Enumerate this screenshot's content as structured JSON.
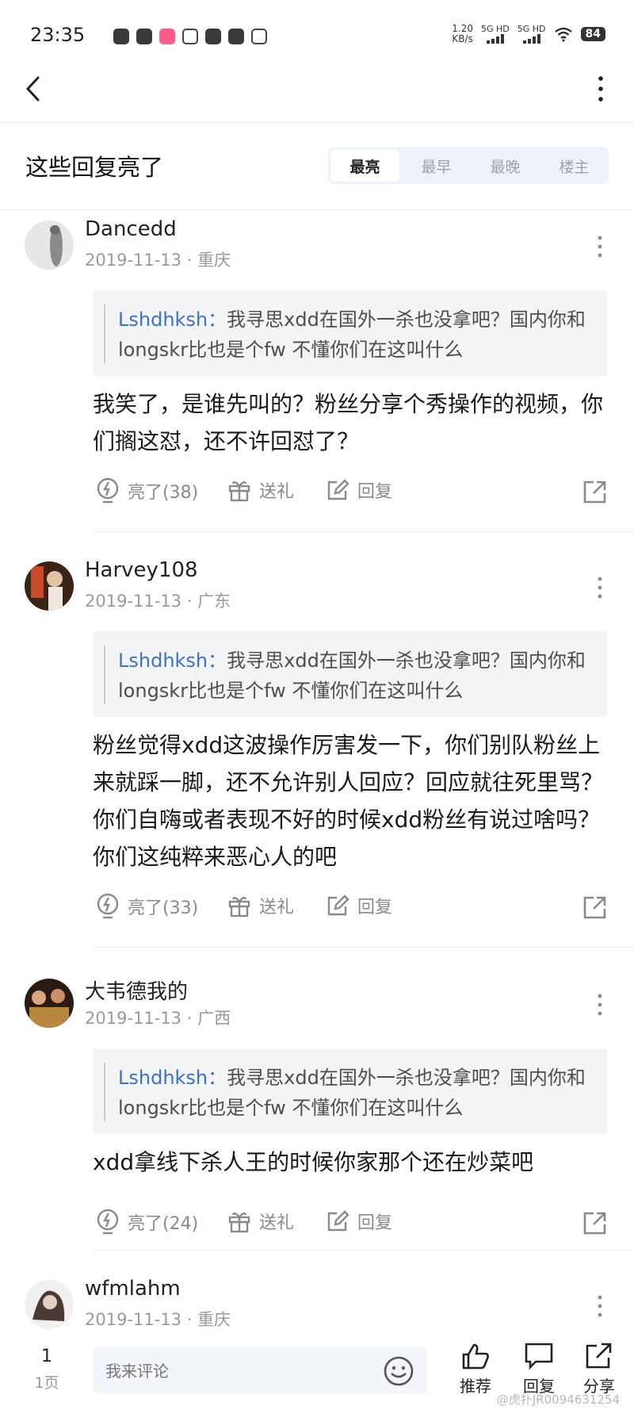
{
  "status_bar": {
    "time": "23:35",
    "net_speed": "1.20",
    "net_unit": "KB/s",
    "sim1": "5G HD",
    "sim2": "5G HD",
    "battery": "84"
  },
  "section": {
    "title": "这些回复亮了",
    "sort_tabs": [
      "最亮",
      "最早",
      "最晚",
      "楼主"
    ],
    "active_tab": "最亮"
  },
  "comments": [
    {
      "user": "Dancedd",
      "date": "2019-11-13",
      "region": "重庆",
      "quote_user": "Lshdhksh：",
      "quote_text": "我寻思xdd在国外一杀也没拿吧？国内你和longskr比也是个fw 不懂你们在这叫什么",
      "body": "我笑了，是谁先叫的？粉丝分享个秀操作的视频，你们搁这怼，还不许回怼了？",
      "likes": "亮了(38)",
      "gift": "送礼",
      "reply": "回复"
    },
    {
      "user": "Harvey108",
      "date": "2019-11-13",
      "region": "广东",
      "quote_user": "Lshdhksh：",
      "quote_text": "我寻思xdd在国外一杀也没拿吧？国内你和longskr比也是个fw 不懂你们在这叫什么",
      "body": "粉丝觉得xdd这波操作厉害发一下，你们别队粉丝上来就踩一脚，还不允许别人回应？回应就往死里骂？你们自嗨或者表现不好的时候xdd粉丝有说过啥吗？你们这纯粹来恶心人的吧",
      "likes": "亮了(33)",
      "gift": "送礼",
      "reply": "回复"
    },
    {
      "user": "大韦德我的",
      "date": "2019-11-13",
      "region": "广西",
      "quote_user": "Lshdhksh：",
      "quote_text": "我寻思xdd在国外一杀也没拿吧？国内你和longskr比也是个fw 不懂你们在这叫什么",
      "body": "xdd拿线下杀人王的时候你家那个还在炒菜吧",
      "likes": "亮了(24)",
      "gift": "送礼",
      "reply": "回复"
    },
    {
      "user": "wfmlahm",
      "date": "2019-11-13",
      "region": "重庆"
    }
  ],
  "bottom_bar": {
    "page_current": "1",
    "page_total": "1页",
    "input_placeholder": "我来评论",
    "recommend": "推荐",
    "reply": "回复",
    "share": "分享",
    "watermark": "@虎扑JR0094631254"
  },
  "colors": {
    "link_blue": "#3d72c9",
    "muted": "#9a9a9a",
    "quote_bg": "#f3f4f6"
  }
}
